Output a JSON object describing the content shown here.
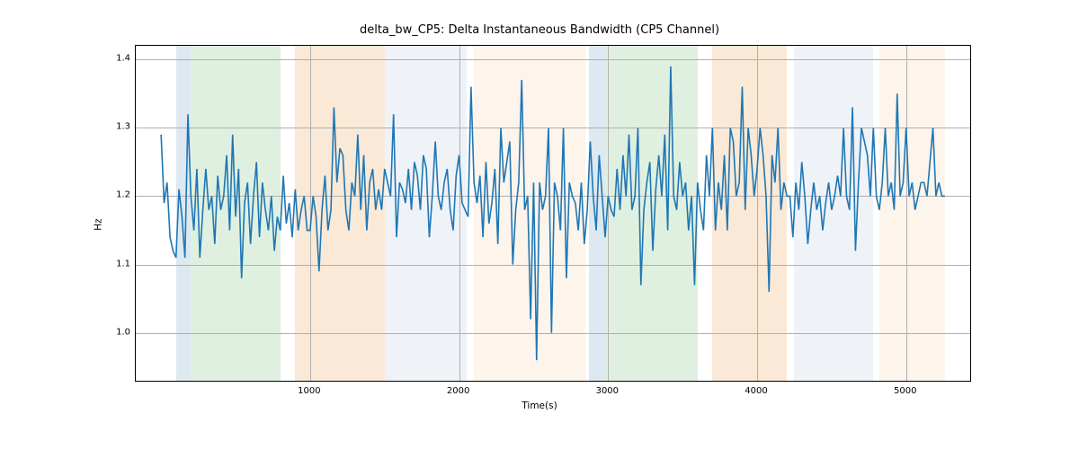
{
  "chart_data": {
    "type": "line",
    "title": "delta_bw_CP5: Delta Instantaneous Bandwidth (CP5 Channel)",
    "xlabel": "Time(s)",
    "ylabel": "Hz",
    "xlim": [
      -170,
      5430
    ],
    "ylim": [
      0.93,
      1.42
    ],
    "xticks": [
      1000,
      2000,
      3000,
      4000,
      5000
    ],
    "yticks": [
      1.0,
      1.1,
      1.2,
      1.3,
      1.4
    ],
    "xticklabels": [
      "1000",
      "2000",
      "3000",
      "4000",
      "5000"
    ],
    "yticklabels": [
      "1.0",
      "1.1",
      "1.2",
      "1.3",
      "1.4"
    ],
    "bands": [
      {
        "x0": 100,
        "x1": 200,
        "color": "#8fb4cc"
      },
      {
        "x0": 200,
        "x1": 800,
        "color": "#98cc98"
      },
      {
        "x0": 900,
        "x1": 1500,
        "color": "#f0b678"
      },
      {
        "x0": 1500,
        "x1": 2050,
        "color": "#cad7e8"
      },
      {
        "x0": 2100,
        "x1": 2850,
        "color": "#f7dcbf"
      },
      {
        "x0": 2870,
        "x1": 2980,
        "color": "#8fb4cc"
      },
      {
        "x0": 2980,
        "x1": 3600,
        "color": "#98cc98"
      },
      {
        "x0": 3700,
        "x1": 4200,
        "color": "#f0b678"
      },
      {
        "x0": 4250,
        "x1": 4780,
        "color": "#cad7e8"
      },
      {
        "x0": 4820,
        "x1": 5260,
        "color": "#f7dcbf"
      }
    ],
    "line_color": "#1f77b4",
    "series": [
      {
        "name": "delta_bw_CP5",
        "x": [
          0,
          20,
          40,
          60,
          80,
          100,
          120,
          140,
          160,
          180,
          200,
          220,
          240,
          260,
          280,
          300,
          320,
          340,
          360,
          380,
          400,
          420,
          440,
          460,
          480,
          500,
          520,
          540,
          560,
          580,
          600,
          620,
          640,
          660,
          680,
          700,
          720,
          740,
          760,
          780,
          800,
          820,
          840,
          860,
          880,
          900,
          920,
          940,
          960,
          980,
          1000,
          1020,
          1040,
          1060,
          1080,
          1100,
          1120,
          1140,
          1160,
          1180,
          1200,
          1220,
          1240,
          1260,
          1280,
          1300,
          1320,
          1340,
          1360,
          1380,
          1400,
          1420,
          1440,
          1460,
          1480,
          1500,
          1520,
          1540,
          1560,
          1580,
          1600,
          1620,
          1640,
          1660,
          1680,
          1700,
          1720,
          1740,
          1760,
          1780,
          1800,
          1820,
          1840,
          1860,
          1880,
          1900,
          1920,
          1940,
          1960,
          1980,
          2000,
          2020,
          2040,
          2060,
          2080,
          2100,
          2120,
          2140,
          2160,
          2180,
          2200,
          2220,
          2240,
          2260,
          2280,
          2300,
          2320,
          2340,
          2360,
          2380,
          2400,
          2420,
          2440,
          2460,
          2480,
          2500,
          2520,
          2540,
          2560,
          2580,
          2600,
          2620,
          2640,
          2660,
          2680,
          2700,
          2720,
          2740,
          2760,
          2780,
          2800,
          2820,
          2840,
          2860,
          2880,
          2900,
          2920,
          2940,
          2960,
          2980,
          3000,
          3020,
          3040,
          3060,
          3080,
          3100,
          3120,
          3140,
          3160,
          3180,
          3200,
          3220,
          3240,
          3260,
          3280,
          3300,
          3320,
          3340,
          3360,
          3380,
          3400,
          3420,
          3440,
          3460,
          3480,
          3500,
          3520,
          3540,
          3560,
          3580,
          3600,
          3620,
          3640,
          3660,
          3680,
          3700,
          3720,
          3740,
          3760,
          3780,
          3800,
          3820,
          3840,
          3860,
          3880,
          3900,
          3920,
          3940,
          3960,
          3980,
          4000,
          4020,
          4040,
          4060,
          4080,
          4100,
          4120,
          4140,
          4160,
          4180,
          4200,
          4220,
          4240,
          4260,
          4280,
          4300,
          4320,
          4340,
          4360,
          4380,
          4400,
          4420,
          4440,
          4460,
          4480,
          4500,
          4520,
          4540,
          4560,
          4580,
          4600,
          4620,
          4640,
          4660,
          4680,
          4700,
          4720,
          4740,
          4760,
          4780,
          4800,
          4820,
          4840,
          4860,
          4880,
          4900,
          4920,
          4940,
          4960,
          4980,
          5000,
          5020,
          5040,
          5060,
          5080,
          5100,
          5120,
          5140,
          5160,
          5180,
          5200,
          5220,
          5240,
          5260
        ],
        "values": [
          1.29,
          1.19,
          1.22,
          1.14,
          1.12,
          1.11,
          1.21,
          1.17,
          1.11,
          1.32,
          1.2,
          1.15,
          1.24,
          1.11,
          1.18,
          1.24,
          1.18,
          1.2,
          1.13,
          1.23,
          1.18,
          1.2,
          1.26,
          1.15,
          1.29,
          1.17,
          1.24,
          1.08,
          1.19,
          1.22,
          1.13,
          1.2,
          1.25,
          1.14,
          1.22,
          1.18,
          1.15,
          1.2,
          1.12,
          1.17,
          1.15,
          1.23,
          1.16,
          1.19,
          1.14,
          1.21,
          1.15,
          1.18,
          1.2,
          1.15,
          1.15,
          1.2,
          1.17,
          1.09,
          1.18,
          1.23,
          1.15,
          1.18,
          1.33,
          1.22,
          1.27,
          1.26,
          1.18,
          1.15,
          1.22,
          1.2,
          1.29,
          1.18,
          1.26,
          1.15,
          1.22,
          1.24,
          1.18,
          1.21,
          1.18,
          1.24,
          1.22,
          1.2,
          1.32,
          1.14,
          1.22,
          1.21,
          1.19,
          1.24,
          1.18,
          1.25,
          1.23,
          1.18,
          1.26,
          1.24,
          1.14,
          1.2,
          1.28,
          1.2,
          1.18,
          1.22,
          1.24,
          1.18,
          1.15,
          1.23,
          1.26,
          1.19,
          1.18,
          1.17,
          1.36,
          1.22,
          1.19,
          1.23,
          1.14,
          1.25,
          1.16,
          1.19,
          1.24,
          1.13,
          1.3,
          1.22,
          1.25,
          1.28,
          1.1,
          1.18,
          1.22,
          1.37,
          1.18,
          1.2,
          1.02,
          1.22,
          0.96,
          1.22,
          1.18,
          1.2,
          1.3,
          1.0,
          1.22,
          1.2,
          1.15,
          1.3,
          1.08,
          1.22,
          1.2,
          1.19,
          1.15,
          1.22,
          1.13,
          1.18,
          1.28,
          1.2,
          1.15,
          1.26,
          1.2,
          1.14,
          1.2,
          1.18,
          1.17,
          1.24,
          1.18,
          1.26,
          1.2,
          1.29,
          1.18,
          1.2,
          1.3,
          1.07,
          1.18,
          1.22,
          1.25,
          1.12,
          1.21,
          1.26,
          1.2,
          1.29,
          1.15,
          1.39,
          1.2,
          1.18,
          1.25,
          1.2,
          1.22,
          1.15,
          1.2,
          1.07,
          1.22,
          1.18,
          1.15,
          1.26,
          1.2,
          1.3,
          1.15,
          1.22,
          1.18,
          1.26,
          1.15,
          1.3,
          1.28,
          1.2,
          1.22,
          1.36,
          1.18,
          1.3,
          1.26,
          1.2,
          1.24,
          1.3,
          1.26,
          1.2,
          1.06,
          1.26,
          1.22,
          1.3,
          1.18,
          1.22,
          1.2,
          1.2,
          1.14,
          1.22,
          1.18,
          1.25,
          1.2,
          1.13,
          1.18,
          1.22,
          1.18,
          1.2,
          1.15,
          1.19,
          1.22,
          1.18,
          1.2,
          1.23,
          1.2,
          1.3,
          1.2,
          1.18,
          1.33,
          1.12,
          1.22,
          1.3,
          1.28,
          1.26,
          1.2,
          1.3,
          1.2,
          1.18,
          1.22,
          1.3,
          1.2,
          1.22,
          1.18,
          1.35,
          1.2,
          1.22,
          1.3,
          1.2,
          1.22,
          1.18,
          1.2,
          1.22,
          1.22,
          1.2,
          1.25,
          1.3,
          1.2,
          1.22,
          1.2,
          1.2
        ]
      }
    ]
  }
}
